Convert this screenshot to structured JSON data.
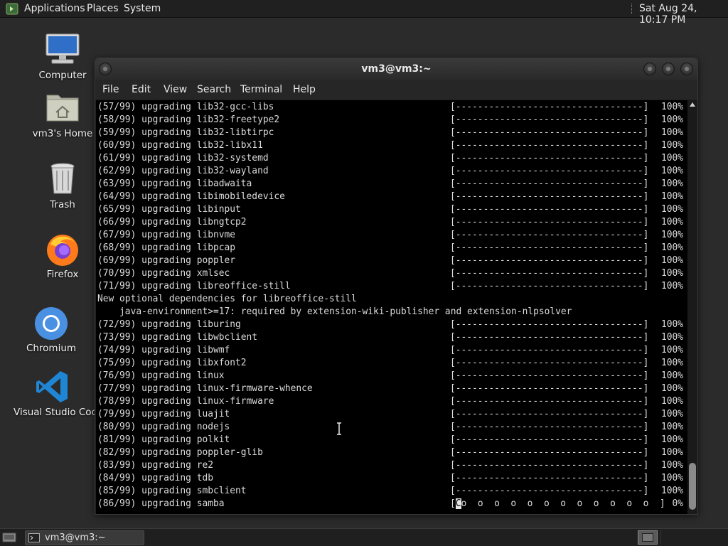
{
  "top_panel": {
    "applications": "Applications",
    "places": "Places",
    "system": "System",
    "clock": "Sat Aug 24, 10:17 PM"
  },
  "desktop_icons": {
    "computer": "Computer",
    "home": "vm3's Home",
    "trash": "Trash",
    "firefox": "Firefox",
    "chromium": "Chromium",
    "vscode": "Visual Studio Code"
  },
  "window": {
    "title": "vm3@vm3:~",
    "menu": {
      "file": "File",
      "edit": "Edit",
      "view": "View",
      "search": "Search",
      "terminal": "Terminal",
      "help": "Help"
    }
  },
  "terminal": {
    "lines": [
      {
        "text": "(57/99) upgrading lib32-gcc-libs",
        "bar": "[----------------------------------]",
        "pct": "100%"
      },
      {
        "text": "(58/99) upgrading lib32-freetype2",
        "bar": "[----------------------------------]",
        "pct": "100%"
      },
      {
        "text": "(59/99) upgrading lib32-libtirpc",
        "bar": "[----------------------------------]",
        "pct": "100%"
      },
      {
        "text": "(60/99) upgrading lib32-libx11",
        "bar": "[----------------------------------]",
        "pct": "100%"
      },
      {
        "text": "(61/99) upgrading lib32-systemd",
        "bar": "[----------------------------------]",
        "pct": "100%"
      },
      {
        "text": "(62/99) upgrading lib32-wayland",
        "bar": "[----------------------------------]",
        "pct": "100%"
      },
      {
        "text": "(63/99) upgrading libadwaita",
        "bar": "[----------------------------------]",
        "pct": "100%"
      },
      {
        "text": "(64/99) upgrading libimobiledevice",
        "bar": "[----------------------------------]",
        "pct": "100%"
      },
      {
        "text": "(65/99) upgrading libinput",
        "bar": "[----------------------------------]",
        "pct": "100%"
      },
      {
        "text": "(66/99) upgrading libngtcp2",
        "bar": "[----------------------------------]",
        "pct": "100%"
      },
      {
        "text": "(67/99) upgrading libnvme",
        "bar": "[----------------------------------]",
        "pct": "100%"
      },
      {
        "text": "(68/99) upgrading libpcap",
        "bar": "[----------------------------------]",
        "pct": "100%"
      },
      {
        "text": "(69/99) upgrading poppler",
        "bar": "[----------------------------------]",
        "pct": "100%"
      },
      {
        "text": "(70/99) upgrading xmlsec",
        "bar": "[----------------------------------]",
        "pct": "100%"
      },
      {
        "text": "(71/99) upgrading libreoffice-still",
        "bar": "[----------------------------------]",
        "pct": "100%"
      },
      {
        "text": "New optional dependencies for libreoffice-still",
        "bar": "",
        "pct": ""
      },
      {
        "text": "    java-environment>=17: required by extension-wiki-publisher and extension-nlpsolver",
        "bar": "",
        "pct": ""
      },
      {
        "text": "(72/99) upgrading liburing",
        "bar": "[----------------------------------]",
        "pct": "100%"
      },
      {
        "text": "(73/99) upgrading libwbclient",
        "bar": "[----------------------------------]",
        "pct": "100%"
      },
      {
        "text": "(74/99) upgrading libwmf",
        "bar": "[----------------------------------]",
        "pct": "100%"
      },
      {
        "text": "(75/99) upgrading libxfont2",
        "bar": "[----------------------------------]",
        "pct": "100%"
      },
      {
        "text": "(76/99) upgrading linux",
        "bar": "[----------------------------------]",
        "pct": "100%"
      },
      {
        "text": "(77/99) upgrading linux-firmware-whence",
        "bar": "[----------------------------------]",
        "pct": "100%"
      },
      {
        "text": "(78/99) upgrading linux-firmware",
        "bar": "[----------------------------------]",
        "pct": "100%"
      },
      {
        "text": "(79/99) upgrading luajit",
        "bar": "[----------------------------------]",
        "pct": "100%"
      },
      {
        "text": "(80/99) upgrading nodejs",
        "bar": "[----------------------------------]",
        "pct": "100%"
      },
      {
        "text": "(81/99) upgrading polkit",
        "bar": "[----------------------------------]",
        "pct": "100%"
      },
      {
        "text": "(82/99) upgrading poppler-glib",
        "bar": "[----------------------------------]",
        "pct": "100%"
      },
      {
        "text": "(83/99) upgrading re2",
        "bar": "[----------------------------------]",
        "pct": "100%"
      },
      {
        "text": "(84/99) upgrading tdb",
        "bar": "[----------------------------------]",
        "pct": "100%"
      },
      {
        "text": "(85/99) upgrading smbclient",
        "bar": "[----------------------------------]",
        "pct": "100%"
      },
      {
        "text": "(86/99) upgrading samba",
        "bar_cursor": "C",
        "bar_rest": "o  o  o  o  o  o  o  o  o  o  o  o  ]",
        "bar_open": "[",
        "pct": "0%"
      }
    ]
  },
  "taskbar": {
    "task_label": "vm3@vm3:~"
  },
  "colors": {
    "desktop_bg": "#2b2b2b",
    "terminal_bg": "#000000",
    "terminal_fg": "#dcdcdc",
    "panel_bg": "#202020"
  }
}
